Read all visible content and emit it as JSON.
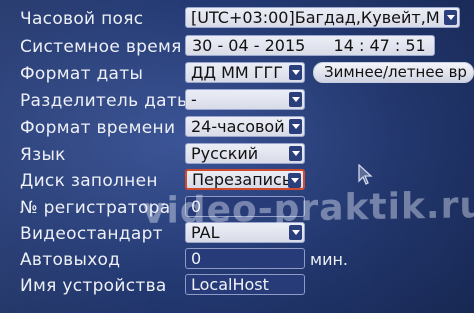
{
  "rows": {
    "timezone": {
      "label": "Часовой пояс",
      "value": "[UTC+03:00]Багдад,Кувейт,М"
    },
    "system_time": {
      "label": "Системное время",
      "date": "30 - 04 - 2015",
      "time": "14 : 47 : 51"
    },
    "date_format": {
      "label": "Формат даты",
      "value": "ДД ММ ГГГ",
      "dst_button": "Зимнее/летнее вр"
    },
    "date_separator": {
      "label": "Разделитель даты",
      "value": "-"
    },
    "time_format": {
      "label": "Формат времени",
      "value": "24-часовой"
    },
    "language": {
      "label": "Язык",
      "value": "Русский"
    },
    "disk_full": {
      "label": "Диск заполнен",
      "value": "Перезапись"
    },
    "recorder_no": {
      "label": "№ регистратора",
      "value": "0"
    },
    "video_standard": {
      "label": "Видеостандарт",
      "value": "PAL"
    },
    "auto_logout": {
      "label": "Автовыход",
      "value": "0",
      "unit": "мин."
    },
    "device_name": {
      "label": "Имя устройства",
      "value": "LocalHost"
    }
  },
  "watermark": "video-praktik.ru",
  "colors": {
    "background": "#2c4382",
    "field": "#e3e6f0",
    "highlight_border": "#d24a2e"
  }
}
